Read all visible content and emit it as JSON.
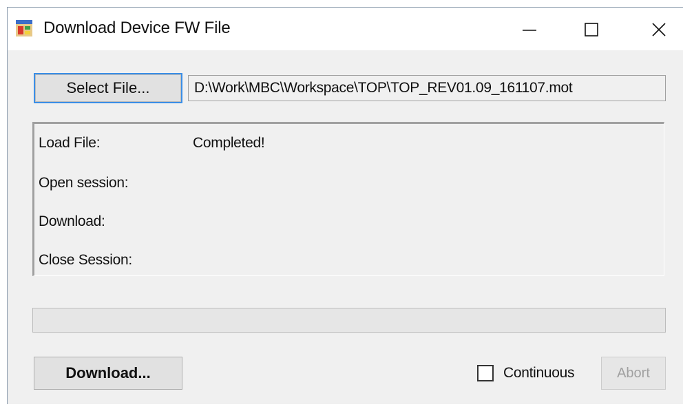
{
  "window": {
    "title": "Download Device FW File"
  },
  "file": {
    "select_label": "Select File...",
    "path": "D:\\Work\\MBC\\Workspace\\TOP\\TOP_REV01.09_161107.mot"
  },
  "status": {
    "rows": [
      {
        "label": "Load File:",
        "value": "Completed!"
      },
      {
        "label": "Open session:",
        "value": ""
      },
      {
        "label": "Download:",
        "value": ""
      },
      {
        "label": "Close Session:",
        "value": ""
      }
    ]
  },
  "progress": {
    "percent": 0
  },
  "actions": {
    "download_label": "Download...",
    "continuous_label": "Continuous",
    "continuous_checked": false,
    "abort_label": "Abort",
    "abort_enabled": false
  },
  "colors": {
    "focus_border": "#3a8ee6",
    "progress_fill": "#06b025"
  },
  "icons": {
    "app": "application-window-icon",
    "minimize": "minimize-icon",
    "maximize": "maximize-icon",
    "close": "close-icon"
  }
}
